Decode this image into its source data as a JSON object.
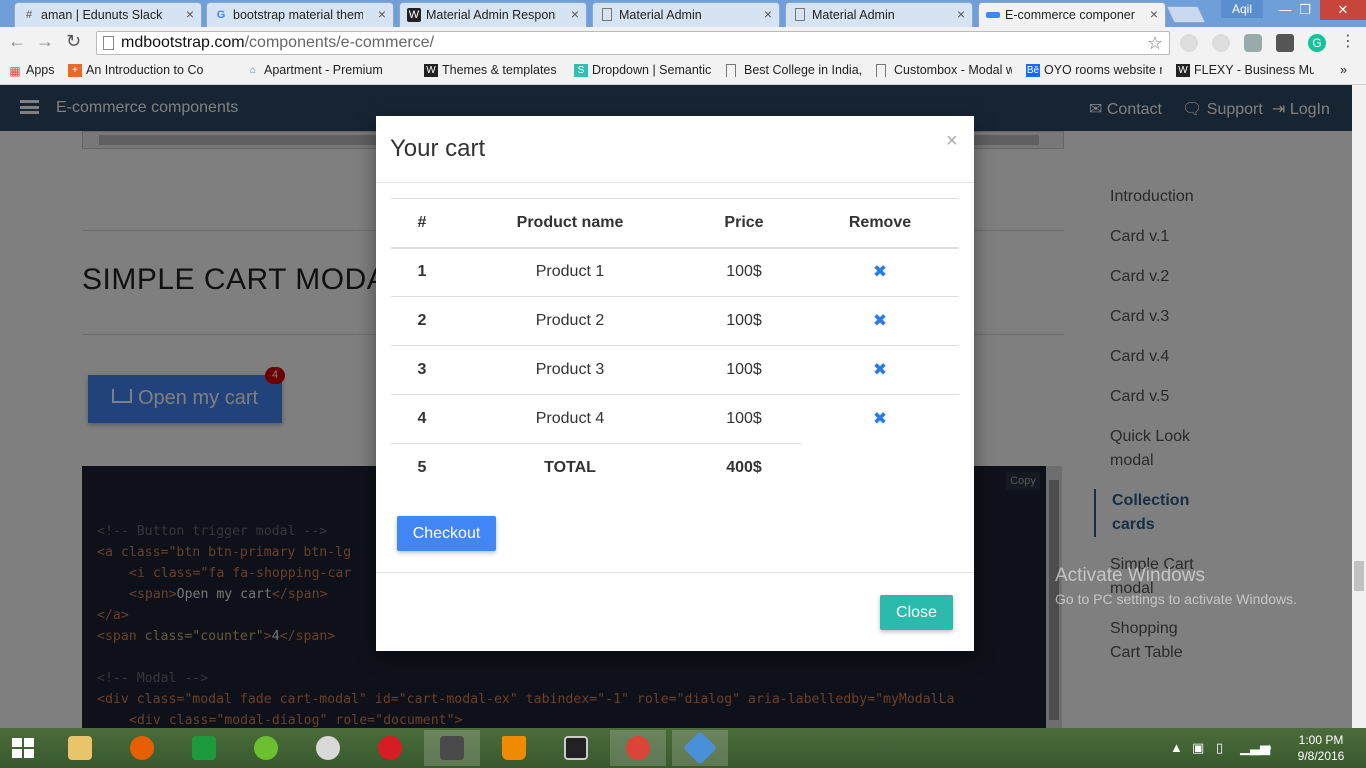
{
  "browser": {
    "tabs": [
      {
        "title": "aman | Edunuts Slack",
        "icon": "slack-hash-icon"
      },
      {
        "title": "bootstrap material theme",
        "icon": "google-icon"
      },
      {
        "title": "Material Admin Responsiv",
        "icon": "w-logo-icon"
      },
      {
        "title": "Material Admin",
        "icon": "page-icon"
      },
      {
        "title": "Material Admin",
        "icon": "page-icon"
      },
      {
        "title": "E-commerce components",
        "icon": "mdb-icon",
        "active": true
      }
    ],
    "user": "Aqil",
    "url_host": "mdbootstrap.com",
    "url_path": "/components/e-commerce/",
    "bookmarks": [
      {
        "label": "Apps",
        "icon": "apps-grid-icon"
      },
      {
        "label": "An Introduction to Co",
        "icon": "plus-icon"
      },
      {
        "label": "",
        "icon": "page-icon"
      },
      {
        "label": "Apartment - Premium",
        "icon": "home-icon"
      },
      {
        "label": "",
        "icon": "page-icon"
      },
      {
        "label": "Themes & templates",
        "icon": "w-logo-icon"
      },
      {
        "label": "Dropdown | Semantic",
        "icon": "s-logo-icon"
      },
      {
        "label": "Best College in India,",
        "icon": "page-icon"
      },
      {
        "label": "Custombox - Modal w",
        "icon": "page-icon"
      },
      {
        "label": "OYO rooms website r",
        "icon": "behance-icon"
      },
      {
        "label": "FLEXY - Business Mult",
        "icon": "w-logo-icon"
      }
    ]
  },
  "site": {
    "brand": "E-commerce components",
    "nav": {
      "contact": "Contact",
      "support": "Support",
      "login": "LogIn"
    }
  },
  "content": {
    "section_title": "SIMPLE CART MODAL",
    "open_cart_label": "Open my cart",
    "counter": "4",
    "copy_label": "Copy",
    "code": [
      "<!-- Button trigger modal -->",
      "<a class=\"btn btn-primary btn-lg",
      "<i class=\"fa fa-shopping-car",
      "Open my cart",
      "</a>",
      "4",
      "<!-- Modal -->",
      "<div class=\"modal fade cart-modal\" id=\"cart-modal-ex\" tabindex=\"-1\" role=\"dialog\" aria-labelledby=\"myModalLa",
      "<div class=\"modal-dialog\" role=\"document\">"
    ]
  },
  "toc": [
    "Introduction",
    "Card v.1",
    "Card v.2",
    "Card v.3",
    "Card v.4",
    "Card v.5",
    "Quick Look modal",
    "Collection cards",
    "Simple Cart modal",
    "Shopping Cart Table"
  ],
  "toc_active": "Collection cards",
  "modal": {
    "title": "Your cart",
    "close_x": "×",
    "headers": [
      "#",
      "Product name",
      "Price",
      "Remove"
    ],
    "rows": [
      {
        "num": "1",
        "name": "Product 1",
        "price": "100$",
        "remove": "✖"
      },
      {
        "num": "2",
        "name": "Product 2",
        "price": "100$",
        "remove": "✖"
      },
      {
        "num": "3",
        "name": "Product 3",
        "price": "100$",
        "remove": "✖"
      },
      {
        "num": "4",
        "name": "Product 4",
        "price": "100$",
        "remove": "✖"
      }
    ],
    "total_row": {
      "num": "5",
      "label": "TOTAL",
      "price": "400$"
    },
    "checkout_label": "Checkout",
    "close_label": "Close"
  },
  "watermark": {
    "line1": "Activate Windows",
    "line2": "Go to PC settings to activate Windows."
  },
  "taskbar": {
    "time": "1:00 PM",
    "date": "9/8/2016"
  },
  "colors": {
    "primary": "#4285f4",
    "close_button": "#2bbbad",
    "navbar": "#2e4a66",
    "code_bg": "#1c2333",
    "remove_icon": "#2a7be4",
    "counter_badge": "#d50000"
  }
}
